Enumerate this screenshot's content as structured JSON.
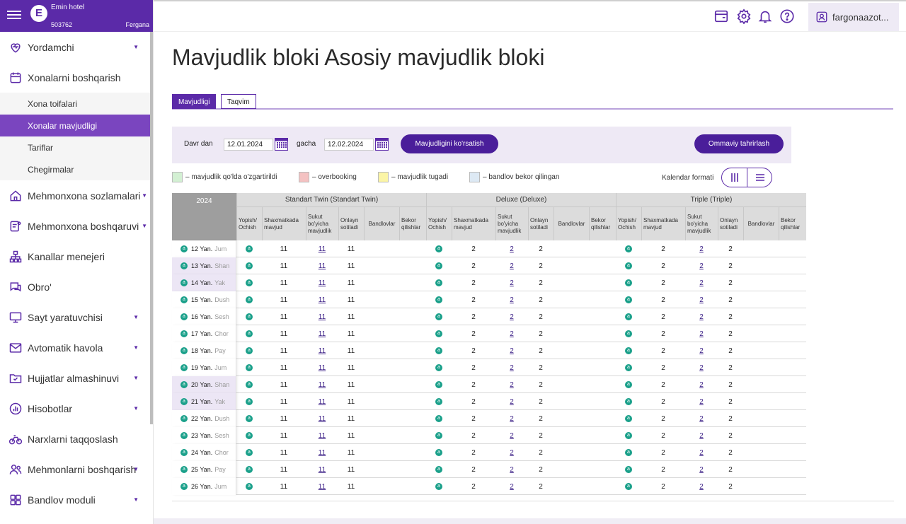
{
  "sidebar": {
    "hotel_name": "Emin hotel",
    "hotel_id": "503762",
    "city": "Fergana",
    "logo_letter": "E",
    "items": [
      {
        "label": "Yordamchi",
        "icon": "heart-pulse-icon",
        "chevron": true
      },
      {
        "label": "Xonalarni boshqarish",
        "icon": "calendar-icon",
        "chevron": false
      },
      {
        "label": "Mehmonxona sozlamalari",
        "icon": "home-icon",
        "chevron": true
      },
      {
        "label": "Mehmonxona boshqaruvi",
        "icon": "document-user-icon",
        "chevron": true
      },
      {
        "label": "Kanallar menejeri",
        "icon": "hierarchy-icon",
        "chevron": false
      },
      {
        "label": "Obro'",
        "icon": "chat-icon",
        "chevron": false
      },
      {
        "label": "Sayt yaratuvchisi",
        "icon": "monitor-icon",
        "chevron": true
      },
      {
        "label": "Avtomatik havola",
        "icon": "mail-icon",
        "chevron": true
      },
      {
        "label": "Hujjatlar almashinuvi",
        "icon": "folder-check-icon",
        "chevron": true
      },
      {
        "label": "Hisobotlar",
        "icon": "chart-icon",
        "chevron": true
      },
      {
        "label": "Narxlarni taqqoslash",
        "icon": "bicycle-icon",
        "chevron": false
      },
      {
        "label": "Mehmonlarni boshqarish",
        "icon": "users-icon",
        "chevron": true
      },
      {
        "label": "Bandlov moduli",
        "icon": "grid-icon",
        "chevron": true
      }
    ],
    "subitems": [
      {
        "label": "Xona toifalari",
        "active": false
      },
      {
        "label": "Xonalar mavjudligi",
        "active": true
      },
      {
        "label": "Tariflar",
        "active": false
      },
      {
        "label": "Chegirmalar",
        "active": false
      }
    ]
  },
  "topbar": {
    "user": "fargonaazot..."
  },
  "page": {
    "title": "Mavjudlik bloki Asosiy mavjudlik bloki",
    "tabs": [
      "Mavjudligi",
      "Taqvim"
    ]
  },
  "filter": {
    "from_label": "Davr dan",
    "from_value": "12.01.2024",
    "to_label": "gacha",
    "to_value": "12.02.2024",
    "show_button": "Mavjudligini ko'rsatish",
    "bulk_button": "Ommaviy tahrirlash"
  },
  "legend": {
    "items": [
      {
        "text": "– mavjudlik qo'lda o'zgartirildi",
        "color": "#d3f0d3"
      },
      {
        "text": "– overbooking",
        "color": "#f4c2c2"
      },
      {
        "text": "– mavjudlik tugadi",
        "color": "#fbf5a6"
      },
      {
        "text": "– bandlov bekor qilingan",
        "color": "#dde9f4"
      }
    ],
    "format_label": "Kalendar formati"
  },
  "grid": {
    "year": "2024",
    "groups": [
      "Standart Twin (Standart Twin)",
      "Deluxe (Deluxe)",
      "Triple (Triple)"
    ],
    "subcolumns": [
      "Yopish/ Ochish",
      "Shaxmatkada mavjud",
      "Sukut bo'yicha mavjudlik",
      "Onlayn sotiladi",
      "Bandlovlar",
      "Bekor qilishlar"
    ],
    "status_glyph": "a",
    "rows": [
      {
        "date": "12 Yan.",
        "day": "Jum",
        "weekend": false,
        "values": [
          [
            "11",
            "11",
            "11"
          ],
          [
            "2",
            "2",
            "2"
          ],
          [
            "2",
            "2",
            "2"
          ]
        ]
      },
      {
        "date": "13 Yan.",
        "day": "Shan",
        "weekend": true,
        "values": [
          [
            "11",
            "11",
            "11"
          ],
          [
            "2",
            "2",
            "2"
          ],
          [
            "2",
            "2",
            "2"
          ]
        ]
      },
      {
        "date": "14 Yan.",
        "day": "Yak",
        "weekend": true,
        "values": [
          [
            "11",
            "11",
            "11"
          ],
          [
            "2",
            "2",
            "2"
          ],
          [
            "2",
            "2",
            "2"
          ]
        ]
      },
      {
        "date": "15 Yan.",
        "day": "Dush",
        "weekend": false,
        "values": [
          [
            "11",
            "11",
            "11"
          ],
          [
            "2",
            "2",
            "2"
          ],
          [
            "2",
            "2",
            "2"
          ]
        ]
      },
      {
        "date": "16 Yan.",
        "day": "Sesh",
        "weekend": false,
        "values": [
          [
            "11",
            "11",
            "11"
          ],
          [
            "2",
            "2",
            "2"
          ],
          [
            "2",
            "2",
            "2"
          ]
        ]
      },
      {
        "date": "17 Yan.",
        "day": "Chor",
        "weekend": false,
        "values": [
          [
            "11",
            "11",
            "11"
          ],
          [
            "2",
            "2",
            "2"
          ],
          [
            "2",
            "2",
            "2"
          ]
        ]
      },
      {
        "date": "18 Yan.",
        "day": "Pay",
        "weekend": false,
        "values": [
          [
            "11",
            "11",
            "11"
          ],
          [
            "2",
            "2",
            "2"
          ],
          [
            "2",
            "2",
            "2"
          ]
        ]
      },
      {
        "date": "19 Yan.",
        "day": "Jum",
        "weekend": false,
        "values": [
          [
            "11",
            "11",
            "11"
          ],
          [
            "2",
            "2",
            "2"
          ],
          [
            "2",
            "2",
            "2"
          ]
        ]
      },
      {
        "date": "20 Yan.",
        "day": "Shan",
        "weekend": true,
        "values": [
          [
            "11",
            "11",
            "11"
          ],
          [
            "2",
            "2",
            "2"
          ],
          [
            "2",
            "2",
            "2"
          ]
        ]
      },
      {
        "date": "21 Yan.",
        "day": "Yak",
        "weekend": true,
        "values": [
          [
            "11",
            "11",
            "11"
          ],
          [
            "2",
            "2",
            "2"
          ],
          [
            "2",
            "2",
            "2"
          ]
        ]
      },
      {
        "date": "22 Yan.",
        "day": "Dush",
        "weekend": false,
        "values": [
          [
            "11",
            "11",
            "11"
          ],
          [
            "2",
            "2",
            "2"
          ],
          [
            "2",
            "2",
            "2"
          ]
        ]
      },
      {
        "date": "23 Yan.",
        "day": "Sesh",
        "weekend": false,
        "values": [
          [
            "11",
            "11",
            "11"
          ],
          [
            "2",
            "2",
            "2"
          ],
          [
            "2",
            "2",
            "2"
          ]
        ]
      },
      {
        "date": "24 Yan.",
        "day": "Chor",
        "weekend": false,
        "values": [
          [
            "11",
            "11",
            "11"
          ],
          [
            "2",
            "2",
            "2"
          ],
          [
            "2",
            "2",
            "2"
          ]
        ]
      },
      {
        "date": "25 Yan.",
        "day": "Pay",
        "weekend": false,
        "values": [
          [
            "11",
            "11",
            "11"
          ],
          [
            "2",
            "2",
            "2"
          ],
          [
            "2",
            "2",
            "2"
          ]
        ]
      },
      {
        "date": "26 Yan.",
        "day": "Jum",
        "weekend": false,
        "values": [
          [
            "11",
            "11",
            "11"
          ],
          [
            "2",
            "2",
            "2"
          ],
          [
            "2",
            "2",
            "2"
          ]
        ]
      }
    ]
  },
  "colors": {
    "brand": "#5b2aa8",
    "button": "#4a1e9a",
    "status_dot": "#1aa08a"
  }
}
